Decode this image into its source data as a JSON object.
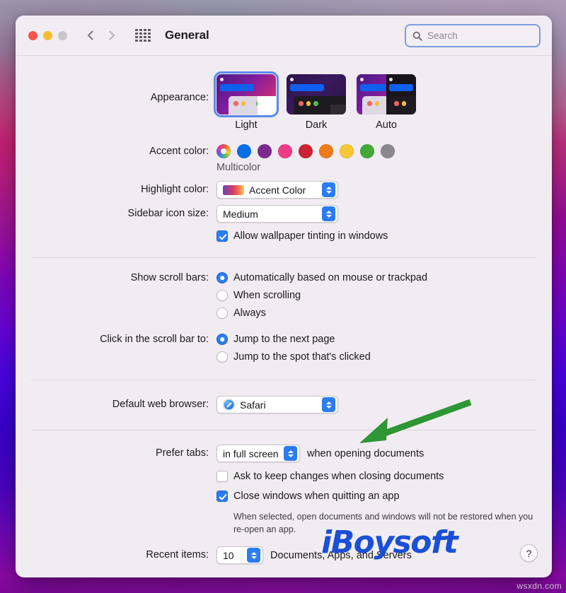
{
  "window": {
    "title": "General",
    "traffic_lights": [
      "close",
      "minimize",
      "zoom"
    ],
    "grid_icon": "grid-icon",
    "back_icon": "chevron-left-icon",
    "forward_icon": "chevron-right-icon"
  },
  "search": {
    "placeholder": "Search",
    "value": "",
    "icon": "search-icon"
  },
  "appearance": {
    "label": "Appearance:",
    "options": [
      {
        "label": "Light",
        "selected": true
      },
      {
        "label": "Dark",
        "selected": false
      },
      {
        "label": "Auto",
        "selected": false
      }
    ]
  },
  "accent_color": {
    "label": "Accent color:",
    "selected_label": "Multicolor",
    "swatches": [
      {
        "name": "multicolor",
        "color": "multicolor"
      },
      {
        "name": "blue",
        "color": "#0a6ee8"
      },
      {
        "name": "purple",
        "color": "#7b2b8e"
      },
      {
        "name": "pink",
        "color": "#ee3b86"
      },
      {
        "name": "red",
        "color": "#cc2233"
      },
      {
        "name": "orange",
        "color": "#ef7a18"
      },
      {
        "name": "yellow",
        "color": "#f7c73a"
      },
      {
        "name": "green",
        "color": "#43a838"
      },
      {
        "name": "graphite",
        "color": "#8a8a8e"
      }
    ]
  },
  "highlight_color": {
    "label": "Highlight color:",
    "value": "Accent Color"
  },
  "sidebar_icon_size": {
    "label": "Sidebar icon size:",
    "value": "Medium"
  },
  "wallpaper_tinting": {
    "label": "Allow wallpaper tinting in windows",
    "checked": true
  },
  "scroll_bars": {
    "label": "Show scroll bars:",
    "options": [
      {
        "label": "Automatically based on mouse or trackpad",
        "selected": true
      },
      {
        "label": "When scrolling",
        "selected": false
      },
      {
        "label": "Always",
        "selected": false
      }
    ]
  },
  "scroll_click": {
    "label": "Click in the scroll bar to:",
    "options": [
      {
        "label": "Jump to the next page",
        "selected": true
      },
      {
        "label": "Jump to the spot that's clicked",
        "selected": false
      }
    ]
  },
  "default_browser": {
    "label": "Default web browser:",
    "value": "Safari",
    "icon": "safari-icon"
  },
  "prefer_tabs": {
    "label": "Prefer tabs:",
    "value": "in full screen",
    "suffix": "when opening documents"
  },
  "ask_keep_changes": {
    "label": "Ask to keep changes when closing documents",
    "checked": false
  },
  "close_windows": {
    "label": "Close windows when quitting an app",
    "checked": true
  },
  "close_windows_hint": "When selected, open documents and windows will not be restored when you re-open an app.",
  "recent_items": {
    "label": "Recent items:",
    "value": "10",
    "suffix": "Documents, Apps, and Servers"
  },
  "help": {
    "label": "?"
  },
  "annotation": {
    "arrow_color": "#2e9634",
    "points_to": "default-web-browser-dropdown"
  },
  "watermark": {
    "text": "iBoysoft",
    "color": "#1a4fd6"
  },
  "site_credit": "wsxdn.com"
}
